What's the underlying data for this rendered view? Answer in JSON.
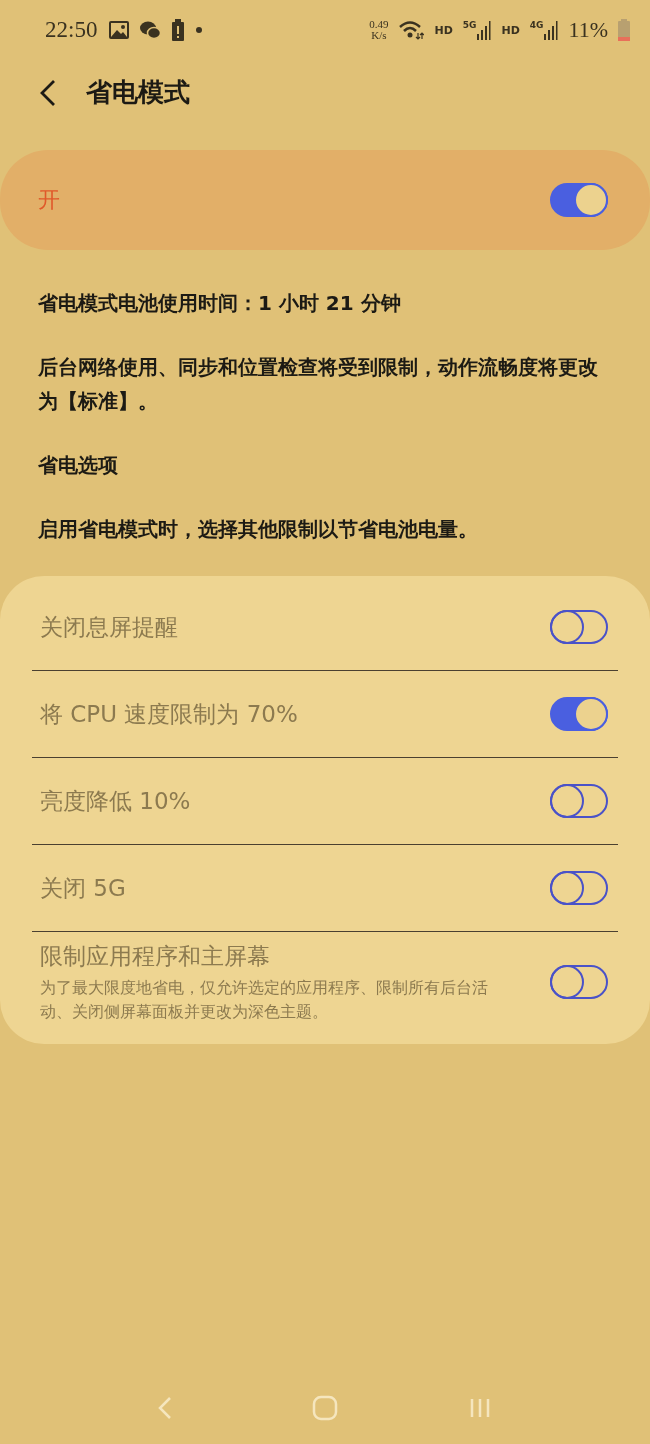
{
  "status_bar": {
    "time": "22:50",
    "net_speed_value": "0.49",
    "net_speed_unit": "K/s",
    "sims": [
      {
        "hd": "HD",
        "network": "5G"
      },
      {
        "hd": "HD",
        "network": "4G"
      }
    ],
    "battery": "11%"
  },
  "header": {
    "title": "省电模式"
  },
  "master": {
    "label": "开",
    "on": true
  },
  "paragraphs": [
    "省电模式电池使用时间：1 小时 21 分钟",
    "后台网络使用、同步和位置检查将受到限制，动作流畅度将更改为【标准】。",
    "省电选项",
    "启用省电模式时，选择其他限制以节省电池电量。"
  ],
  "options": [
    {
      "label": "关闭息屏提醒",
      "on": false
    },
    {
      "label": "将 CPU 速度限制为 70%",
      "on": true
    },
    {
      "label": "亮度降低 10%",
      "on": false
    },
    {
      "label": "关闭 5G",
      "on": false
    },
    {
      "label": "限制应用程序和主屏幕",
      "subtitle": "为了最大限度地省电，仅允许选定的应用程序、限制所有后台活动、关闭侧屏幕面板并更改为深色主题。",
      "on": false
    }
  ]
}
